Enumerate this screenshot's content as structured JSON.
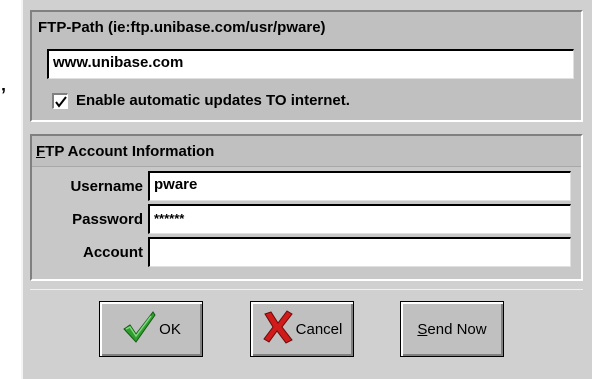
{
  "stray_glyph": "’",
  "ftp_group": {
    "title": "FTP-Path (ie:ftp.unibase.com/usr/pware)",
    "path_value": "www.unibase.com",
    "auto_update_checked": true,
    "auto_update_label": "Enable automatic updates TO internet."
  },
  "account_group": {
    "title_mnemonic": "F",
    "title_rest": "TP Account Information",
    "username_label": "Username",
    "username_value": "pware",
    "password_label": "Password",
    "password_value": "******",
    "account_label": "Account",
    "account_value": ""
  },
  "buttons": {
    "ok_label": "OK",
    "ok_icon": "green-checkmark-icon",
    "cancel_label": "Cancel",
    "cancel_icon": "red-x-icon",
    "send_mnemonic": "S",
    "send_rest": "end Now"
  },
  "colors": {
    "dialog_bg": "#c0c0c0",
    "check_green": "#2f9e2f",
    "cancel_red": "#d11a1a"
  }
}
